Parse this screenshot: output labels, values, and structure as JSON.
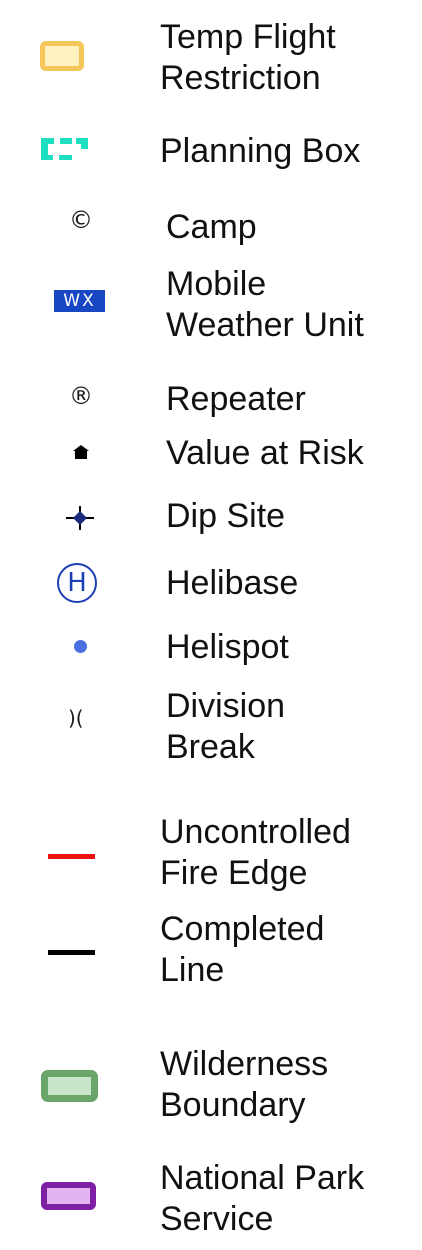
{
  "legend": {
    "items": [
      {
        "id": "tfr",
        "label_lines": [
          "Temp Flight",
          "Restriction"
        ],
        "icon": "rounded-box-icon",
        "color": "#f5c75b",
        "fill": "#fff2bf"
      },
      {
        "id": "planning",
        "label_lines": [
          "Planning Box"
        ],
        "icon": "dashed-box-icon",
        "color": "#1ee0c0"
      },
      {
        "id": "camp",
        "label_lines": [
          "Camp"
        ],
        "icon": "copyright-c-icon",
        "glyph": "©"
      },
      {
        "id": "mwu",
        "label_lines": [
          "Mobile",
          "Weather Unit"
        ],
        "icon": "wx-badge-icon",
        "badge_text": "WX",
        "color": "#1747c2"
      },
      {
        "id": "repeater",
        "label_lines": [
          "Repeater"
        ],
        "icon": "registered-r-icon",
        "glyph": "®"
      },
      {
        "id": "var",
        "label_lines": [
          "Value at Risk"
        ],
        "icon": "house-icon"
      },
      {
        "id": "dip",
        "label_lines": [
          "Dip Site"
        ],
        "icon": "crosshair-diamond-icon"
      },
      {
        "id": "helibase",
        "label_lines": [
          "Helibase"
        ],
        "icon": "circled-h-icon",
        "glyph": "H",
        "color": "#1b3fb5"
      },
      {
        "id": "helispot",
        "label_lines": [
          "Helispot"
        ],
        "icon": "dot-icon",
        "color": "#4a6fe0"
      },
      {
        "id": "division",
        "label_lines": [
          "Division",
          "Break"
        ],
        "icon": "parens-icon",
        "glyph": ")("
      },
      {
        "id": "uncontrolled",
        "label_lines": [
          "Uncontrolled",
          "Fire Edge"
        ],
        "icon": "red-line-icon",
        "color": "#ee1111"
      },
      {
        "id": "completed",
        "label_lines": [
          "Completed",
          "Line"
        ],
        "icon": "black-line-icon",
        "color": "#000000"
      },
      {
        "id": "wilderness",
        "label_lines": [
          "Wilderness",
          "Boundary"
        ],
        "icon": "rounded-box-icon",
        "color": "#6aa56a",
        "fill": "#c8e6c8"
      },
      {
        "id": "nps",
        "label_lines": [
          "National Park",
          "Service"
        ],
        "icon": "rounded-box-icon",
        "color": "#7d20a6",
        "fill": "#e3b3f2"
      }
    ]
  }
}
